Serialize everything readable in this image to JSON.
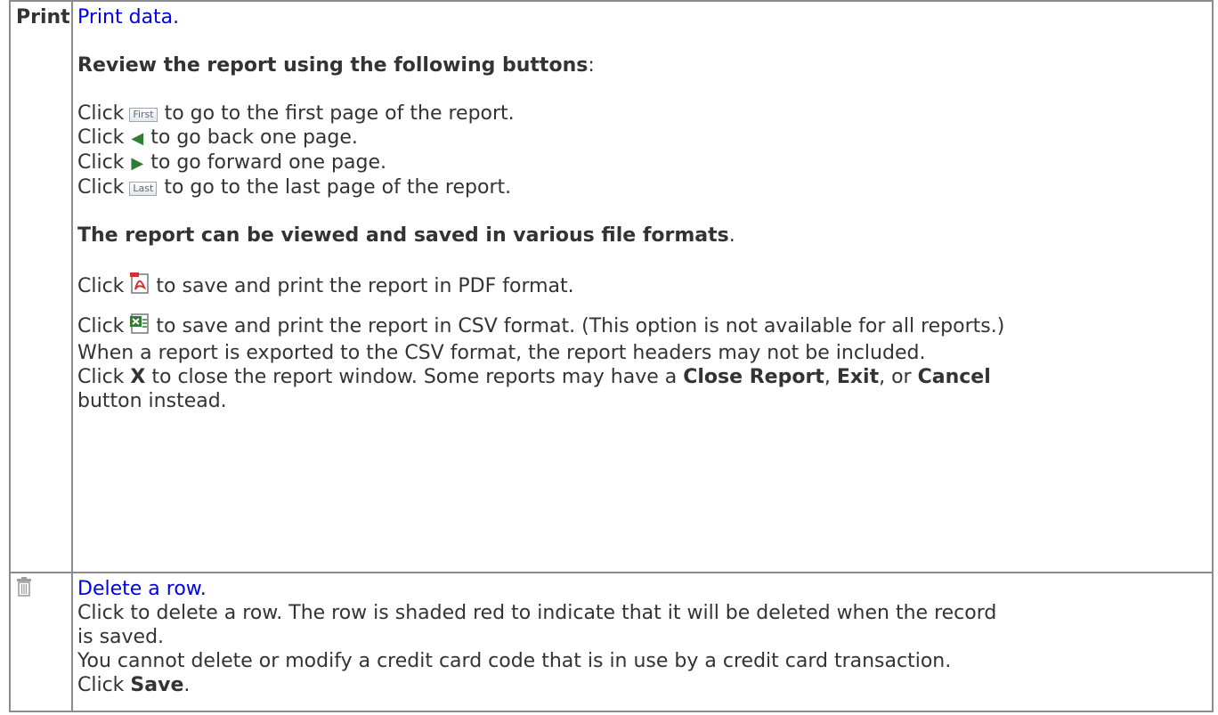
{
  "print_row": {
    "key_label": "Print",
    "link_text": "Print data.",
    "review_heading": "Review the report using the following buttons",
    "review_colon": ":",
    "click_word": "Click",
    "first_btn": "First",
    "first_text": "to go to the first page of the report.",
    "back_text": "to go back one page.",
    "forward_text": "to go forward one page.",
    "last_btn": "Last",
    "last_text": "to go to the last page of the report.",
    "formats_heading": "The report can be viewed and saved in various file formats",
    "formats_period": ".",
    "pdf_text": "to save and print the report in PDF format.",
    "csv_text": "to save and print the report in CSV format. (This option is not available for all reports.)",
    "csv_note": "When a report is exported to the CSV format, the report headers may not be included.",
    "close_pre": "Click ",
    "close_x": "X",
    "close_mid": " to close the report window. Some reports may have a ",
    "close_report": "Close Report",
    "comma1": ", ",
    "exit": "Exit",
    "or_text": ", or ",
    "cancel": "Cancel",
    "close_post": "button instead."
  },
  "delete_row": {
    "icon": "trash-icon",
    "link_text": "Delete a row.",
    "line1": "Click to delete a row. The row is shaded red to indicate that it will be deleted when the record",
    "line2": "is saved.",
    "line3": "You cannot delete or modify a credit card code that is in use by a credit card transaction.",
    "save_pre": "Click ",
    "save_word": "Save",
    "save_post": "."
  },
  "colors": {
    "link": "#0000ee",
    "border": "#8c8c8c",
    "arrow": "#2e7d32",
    "pdf": "#d32f2f",
    "excel": "#2e7d32"
  }
}
